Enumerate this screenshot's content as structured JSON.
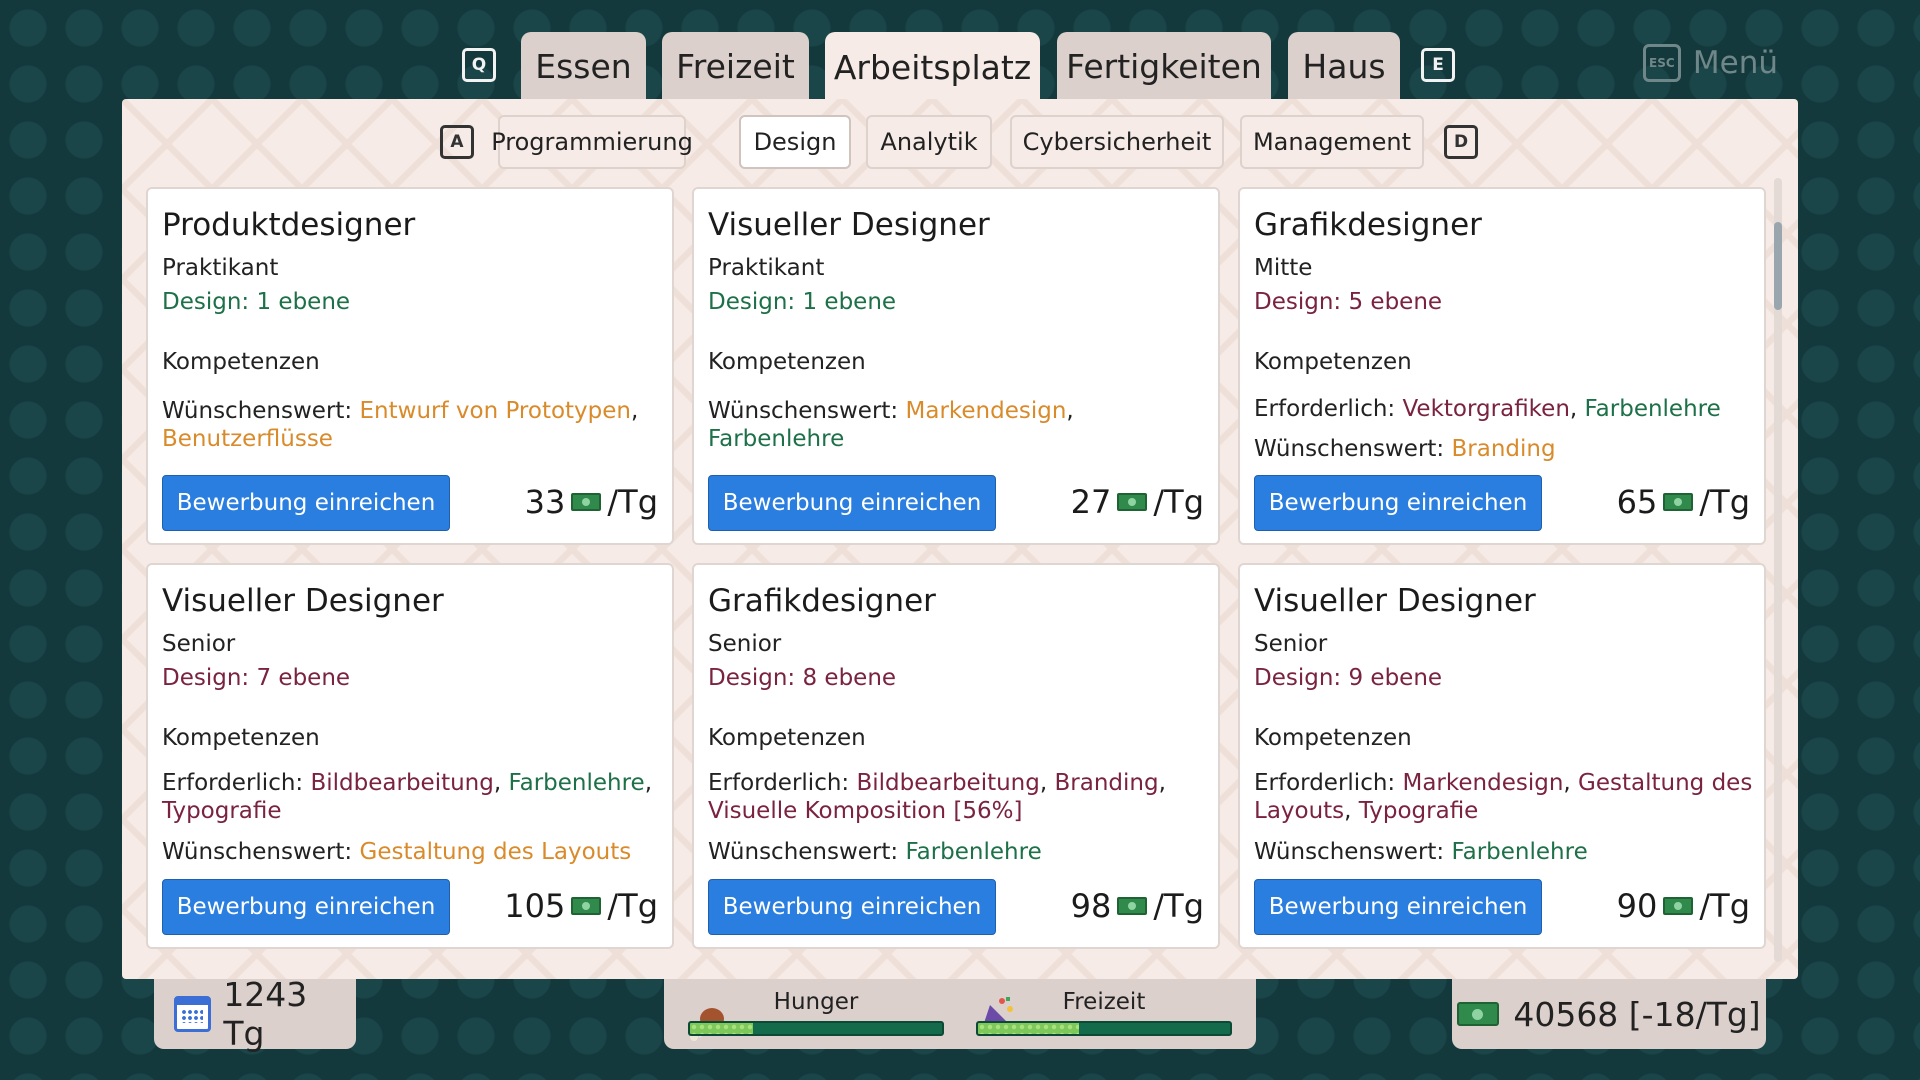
{
  "top_tabs": {
    "prev_key": "Q",
    "next_key": "E",
    "items": [
      {
        "label": "Essen"
      },
      {
        "label": "Freizeit"
      },
      {
        "label": "Arbeitsplatz"
      },
      {
        "label": "Fertigkeiten"
      },
      {
        "label": "Haus"
      }
    ],
    "active": "Arbeitsplatz"
  },
  "menu": {
    "key": "ESC",
    "label": "Menü"
  },
  "sub_tabs": {
    "prev_key": "A",
    "next_key": "D",
    "items": [
      {
        "label": "Programmierung"
      },
      {
        "label": "Design"
      },
      {
        "label": "Analytik"
      },
      {
        "label": "Cybersicherheit"
      },
      {
        "label": "Management"
      }
    ],
    "active": "Design"
  },
  "cards": [
    {
      "title": "Produktdesigner",
      "level": "Praktikant",
      "requirement": "Design: 1 ebene",
      "competencies": "Kompetenzen",
      "required_label": "",
      "required": "",
      "desired_label": "Wünschenswert: ",
      "desired_1": "Entwurf von Prototypen",
      "desired_sep": ",",
      "desired_2": "Benutzerflüsse",
      "button": "Bewerbung einreichen",
      "pay": "33",
      "pay_unit": "/Tg"
    },
    {
      "title": "Visueller Designer",
      "level": "Praktikant",
      "requirement": "Design: 1 ebene",
      "competencies": "Kompetenzen",
      "desired_label": "Wünschenswert: ",
      "desired_1": "Markendesign",
      "desired_sep": ", ",
      "desired_2": "Farbenlehre",
      "button": "Bewerbung einreichen",
      "pay": "27",
      "pay_unit": "/Tg"
    },
    {
      "title": "Grafikdesigner",
      "level": "Mitte",
      "requirement": "Design: 5 ebene",
      "competencies": "Kompetenzen",
      "required_label": "Erforderlich: ",
      "required_1": "Vektorgrafiken",
      "required_sep": ", ",
      "required_2": "Farbenlehre",
      "desired_label": "Wünschenswert: ",
      "desired_1": "Branding",
      "button": "Bewerbung einreichen",
      "pay": "65",
      "pay_unit": "/Tg"
    },
    {
      "title": "Visueller Designer",
      "level": "Senior",
      "requirement": "Design: 7 ebene",
      "competencies": "Kompetenzen",
      "required_label": "Erforderlich: ",
      "required_1": "Bildbearbeitung",
      "required_sep": ", ",
      "required_2": "Farbenlehre",
      "required_sep2": ",",
      "required_3": "Typografie",
      "desired_label": "Wünschenswert: ",
      "desired_1": "Gestaltung des Layouts",
      "button": "Bewerbung einreichen",
      "pay": "105",
      "pay_unit": "/Tg"
    },
    {
      "title": "Grafikdesigner",
      "level": "Senior",
      "requirement": "Design: 8 ebene",
      "competencies": "Kompetenzen",
      "required_label": "Erforderlich: ",
      "required_1": "Bildbearbeitung",
      "required_sep": ", ",
      "required_2": "Branding",
      "required_sep2": ",",
      "required_3": "Visuelle Komposition [56%]",
      "desired_label": "Wünschenswert: ",
      "desired_1": "Farbenlehre",
      "button": "Bewerbung einreichen",
      "pay": "98",
      "pay_unit": "/Tg"
    },
    {
      "title": "Visueller Designer",
      "level": "Senior",
      "requirement": "Design: 9 ebene",
      "competencies": "Kompetenzen",
      "required_label": "Erforderlich: ",
      "required_1": "Markendesign",
      "required_sep": ", ",
      "required_2": "Gestaltung des",
      "required_sep2": "",
      "required_3": "Layouts",
      "required_sep3": ", ",
      "required_4": "Typografie",
      "desired_label": "Wünschenswert: ",
      "desired_1": "Farbenlehre",
      "button": "Bewerbung einreichen",
      "pay": "90",
      "pay_unit": "/Tg"
    }
  ],
  "status": {
    "days": "1243 Tg",
    "hunger_label": "Hunger",
    "hunger_level": 0.25,
    "leisure_label": "Freizeit",
    "leisure_level": 0.4,
    "money": "40568 [-18/Tg]"
  },
  "colors": {
    "background": "#14393d",
    "panel": "#f6ebe6",
    "button": "#2a7ee0",
    "met": "#1d7048",
    "unmet": "#7a2340",
    "desired": "#d98b2b"
  }
}
